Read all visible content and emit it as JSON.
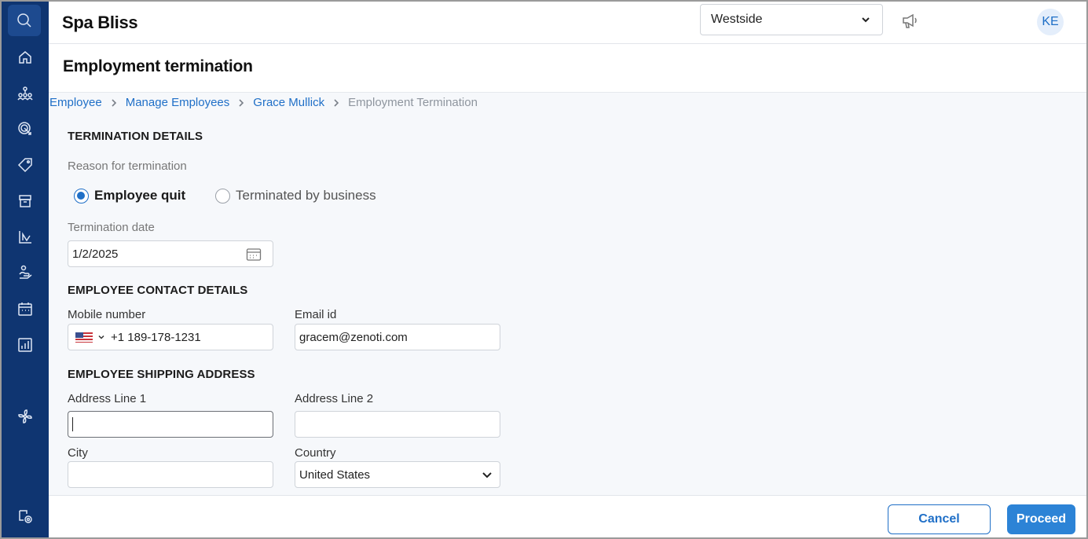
{
  "app": {
    "brand": "Spa Bliss"
  },
  "topbar": {
    "location": "Westside",
    "avatar_initials": "KE"
  },
  "page": {
    "title": "Employment termination"
  },
  "breadcrumb": [
    {
      "label": "Employee"
    },
    {
      "label": "Manage Employees"
    },
    {
      "label": "Grace Mullick"
    },
    {
      "label": "Employment Termination"
    }
  ],
  "termination": {
    "section_title": "TERMINATION DETAILS",
    "reason_label": "Reason for termination",
    "options": [
      {
        "label": "Employee quit",
        "selected": true
      },
      {
        "label": "Terminated by business",
        "selected": false
      }
    ],
    "date_label": "Termination date",
    "date_value": "1/2/2025"
  },
  "contact": {
    "section_title": "EMPLOYEE CONTACT DETAILS",
    "mobile_label": "Mobile number",
    "mobile_value": "+1 189-178-1231",
    "email_label": "Email id",
    "email_value": "gracem@zenoti.com"
  },
  "address": {
    "section_title": "EMPLOYEE SHIPPING ADDRESS",
    "line1_label": "Address Line 1",
    "line1_value": "",
    "line2_label": "Address Line 2",
    "line2_value": "",
    "city_label": "City",
    "city_value": "",
    "country_label": "Country",
    "country_value": "United States"
  },
  "footer": {
    "cancel_label": "Cancel",
    "proceed_label": "Proceed"
  },
  "colors": {
    "sidebar": "#0f3571",
    "accent": "#1f6fc7",
    "primary_button": "#2c83d6"
  },
  "sidebar_icons": [
    "search-icon",
    "home-icon",
    "org-chart-icon",
    "target-icon",
    "tag-icon",
    "box-icon",
    "reports-icon",
    "hand-service-icon",
    "calendar-icon",
    "analytics-icon",
    "fan-icon",
    "settings-icon"
  ]
}
